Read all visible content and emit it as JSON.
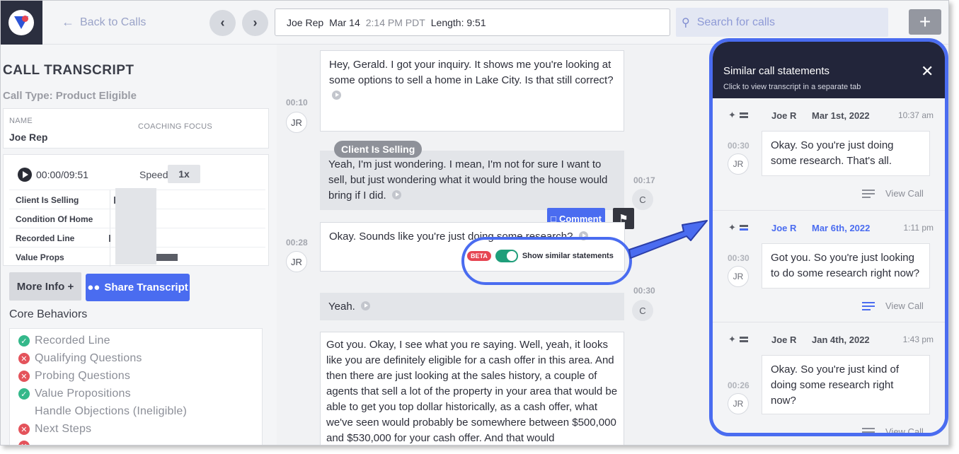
{
  "header": {
    "back_label": "Back to Calls",
    "call_rep": "Joe Rep",
    "call_date": "Mar 14",
    "call_time": "2:14 PM PDT",
    "call_length": "Length: 9:51",
    "search_placeholder": "Search for calls",
    "add_label": "+"
  },
  "left": {
    "title": "CALL TRANSCRIPT",
    "call_type": "Call Type: Product Eligible",
    "name_label": "NAME",
    "name_value": "Joe Rep",
    "coaching_label": "COACHING FOCUS",
    "player_time": "00:00/09:51",
    "speed_label": "Speed",
    "speed_value": "1x",
    "tracks": [
      "Client Is Selling",
      "Condition Of Home",
      "Recorded Line",
      "Value Props"
    ],
    "more_info_label": "More Info +",
    "share_label": "Share Transcript",
    "core_title": "Core Behaviors",
    "core_items": [
      {
        "label": "Recorded Line",
        "status": "ok"
      },
      {
        "label": "Qualifying Questions",
        "status": "bad"
      },
      {
        "label": "Probing Questions",
        "status": "bad"
      },
      {
        "label": "Value Propositions",
        "status": "ok"
      },
      {
        "label": "Handle Objections (Ineligible)",
        "status": "none"
      },
      {
        "label": "Next Steps",
        "status": "bad"
      }
    ]
  },
  "transcript": {
    "m1_text": "Hey, Gerald. I got your inquiry. It shows me you're looking at some options to sell a home in Lake City. Is that still correct?",
    "m1_time": "00:10",
    "m1_avatar": "JR",
    "tag_label": "Client Is Selling",
    "m2_text": "Yeah, I'm just wondering. I mean, I'm not for sure I want to sell, but just wondering what it would bring the house would bring if I did.",
    "m2_time": "00:17",
    "m2_avatar": "C",
    "comment_label": "Comment",
    "m3_text": "Okay. Sounds like you're just doing some research?",
    "m3_time": "00:28",
    "m3_avatar": "JR",
    "beta_label": "BETA",
    "similar_toggle_label": "Show similar statements",
    "m4_text": "Yeah.",
    "m4_time": "00:30",
    "m4_avatar": "C",
    "m5_text": "Got you. Okay, I see what you re saying. Well, yeah, it looks like you are definitely eligible for a cash offer in this area. And then there are just looking at the sales history, a couple of agents that sell a lot of the property in your area that would be able to get you top dollar historically, as a cash offer, what we've seen would probably be somewhere between $500,000 and $530,000 for your cash offer. And that would"
  },
  "similar": {
    "title": "Similar call statements",
    "subtitle": "Click to view transcript in a separate tab",
    "items": [
      {
        "name": "Joe R",
        "date": "Mar 1st, 2022",
        "time": "10:37 am",
        "ts": "00:30",
        "avatar": "JR",
        "text": "Okay. So you're just doing some research. That's all.",
        "view": "View Call"
      },
      {
        "name": "Joe R",
        "date": "Mar 6th, 2022",
        "time": "1:11 pm",
        "ts": "00:30",
        "avatar": "JR",
        "text": "Got you. So you're just looking to do some research right now?",
        "view": "View Call"
      },
      {
        "name": "Joe R",
        "date": "Jan 4th, 2022",
        "time": "1:43 pm",
        "ts": "00:26",
        "avatar": "JR",
        "text": "Okay. So you're just kind of doing some research right now?",
        "view": "View Call"
      }
    ]
  },
  "colors": {
    "accent": "#4a6cf0",
    "dark": "#22253a",
    "toggle": "#1f9e7a",
    "beta": "#e64552"
  }
}
